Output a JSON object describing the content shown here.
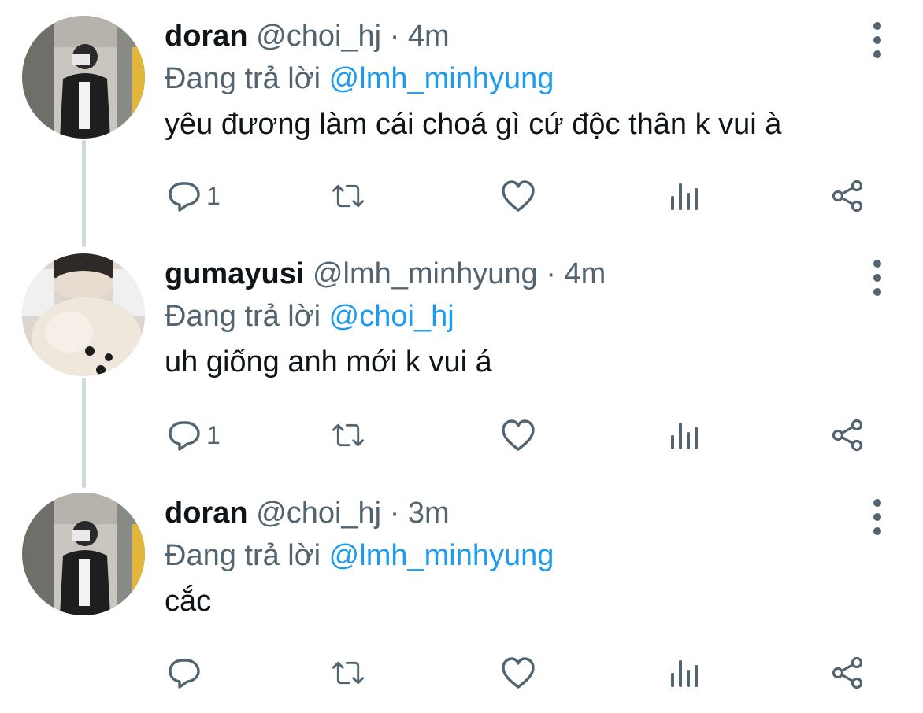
{
  "tweets": [
    {
      "name": "doran",
      "handle": "@choi_hj",
      "separator": "·",
      "time": "4m",
      "reply_prefix": "Đang trả lời",
      "reply_to": "@lmh_minhyung",
      "text": "yêu đương làm cái choá gì cứ độc thân k vui à",
      "reply_count": "1",
      "avatar": "photo-person"
    },
    {
      "name": "gumayusi",
      "handle": "@lmh_minhyung",
      "separator": "·",
      "time": "4m",
      "reply_prefix": "Đang trả lời",
      "reply_to": "@choi_hj",
      "text": "uh giống anh mới k vui á",
      "reply_count": "1",
      "avatar": "photo-dog"
    },
    {
      "name": "doran",
      "handle": "@choi_hj",
      "separator": "·",
      "time": "3m",
      "reply_prefix": "Đang trả lời",
      "reply_to": "@lmh_minhyung",
      "text": "cắc",
      "reply_count": "",
      "avatar": "photo-person"
    }
  ],
  "icons": {
    "reply": "reply-icon",
    "retweet": "retweet-icon",
    "like": "like-icon",
    "analytics": "analytics-icon",
    "share": "share-icon",
    "more": "more-icon"
  },
  "colors": {
    "mention": "#1d9bf0",
    "secondary_text": "#536471",
    "primary_text": "#0f1419",
    "thread_line": "#cfd9de"
  }
}
